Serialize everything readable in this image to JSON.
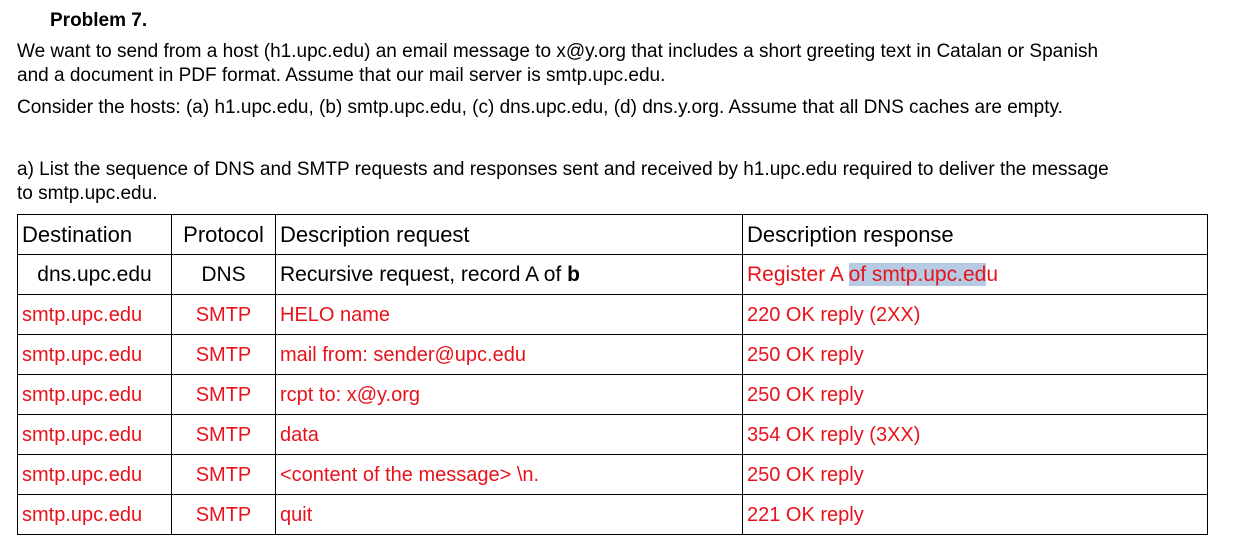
{
  "problem": {
    "title": "Problem 7.",
    "statement_line1": "We want to send from a host (h1.upc.edu) an email message to x@y.org that includes a short greeting text in Catalan or Spanish",
    "statement_line2": "and a document in PDF format. Assume that our mail server is smtp.upc.edu.",
    "consider": "Consider the hosts: (a) h1.upc.edu, (b) smtp.upc.edu, (c) dns.upc.edu, (d) dns.y.org. Assume that all DNS caches are empty.",
    "question_line1": "a) List the sequence of DNS and SMTP requests and responses sent and received by h1.upc.edu required to deliver the message",
    "question_line2": "to smtp.upc.edu."
  },
  "table": {
    "headers": {
      "destination": "Destination",
      "protocol": "Protocol",
      "request": "Description request",
      "response": "Description response"
    },
    "dns_row": {
      "destination": "dns.upc.edu",
      "protocol": "DNS",
      "request_prefix": "Recursive request, record A of ",
      "request_bold": "b",
      "response_prefix": "Register A ",
      "response_selected": "of smtp.upc.ed",
      "response_suffix": "u"
    },
    "smtp_rows": [
      {
        "destination": "smtp.upc.edu",
        "protocol": "SMTP",
        "request": "HELO name",
        "response": "220 OK reply (2XX)"
      },
      {
        "destination": "smtp.upc.edu",
        "protocol": "SMTP",
        "request": "mail from: sender@upc.edu",
        "response": "250  OK reply"
      },
      {
        "destination": "smtp.upc.edu",
        "protocol": "SMTP",
        "request": "rcpt to: x@y.org",
        "response": "250  OK reply"
      },
      {
        "destination": "smtp.upc.edu",
        "protocol": "SMTP",
        "request": "data",
        "response": "354 OK reply (3XX)"
      },
      {
        "destination": "smtp.upc.edu",
        "protocol": "SMTP",
        "request": "<content of the message> \\n.",
        "response": "250  OK reply"
      },
      {
        "destination": "smtp.upc.edu",
        "protocol": "SMTP",
        "request": "quit",
        "response": "221  OK reply"
      }
    ]
  },
  "colors": {
    "answer_text": "#e8121b",
    "selection_highlight": "#b6cbe3"
  }
}
